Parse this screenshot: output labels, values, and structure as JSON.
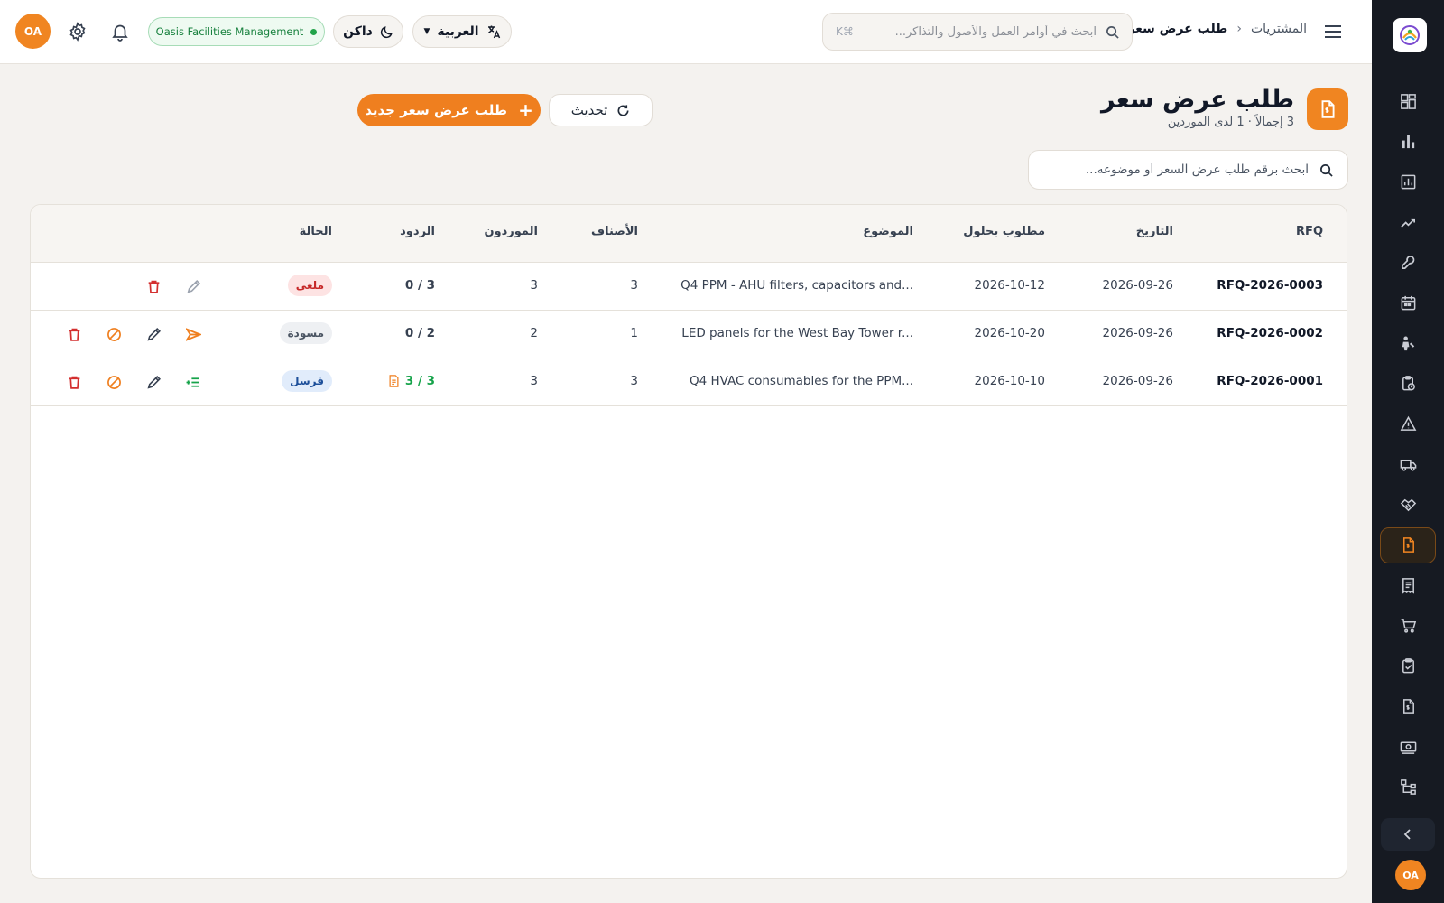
{
  "topbar": {
    "breadcrumb_parent": "المشتريات",
    "breadcrumb_current": "طلب عرض سعر",
    "search_placeholder": "ابحث في أوامر العمل والأصول والتذاكر...",
    "search_shortcut": "⌘K",
    "language": "العربية",
    "theme": "داكن",
    "org_name": "Oasis Facilities Management",
    "avatar_initials": "OA"
  },
  "sidebar": {
    "avatar_initials": "OA",
    "items": [
      {
        "icon": "dashboard-icon",
        "active": false
      },
      {
        "icon": "bar-chart-icon",
        "active": false
      },
      {
        "icon": "report-chart-icon",
        "active": false
      },
      {
        "icon": "trend-icon",
        "active": false
      },
      {
        "icon": "wrench-icon",
        "active": false
      },
      {
        "icon": "calendar-icon",
        "active": false
      },
      {
        "icon": "technician-icon",
        "active": false
      },
      {
        "icon": "clipboard-clock-icon",
        "active": false
      },
      {
        "icon": "warning-icon",
        "active": false
      },
      {
        "icon": "truck-icon",
        "active": false
      },
      {
        "icon": "handshake-icon",
        "active": false
      },
      {
        "icon": "rfq-document-icon",
        "active": true
      },
      {
        "icon": "receipt-icon",
        "active": false
      },
      {
        "icon": "cart-icon",
        "active": false
      },
      {
        "icon": "clipboard-check-icon",
        "active": false
      },
      {
        "icon": "invoice-icon",
        "active": false
      },
      {
        "icon": "payment-icon",
        "active": false
      },
      {
        "icon": "hierarchy-icon",
        "active": false
      }
    ]
  },
  "page": {
    "title": "طلب عرض سعر",
    "subtitle": "3 إجمالاً · 1 لدى الموردين",
    "refresh_label": "تحديث",
    "new_label": "طلب عرض سعر جديد",
    "search_placeholder": "ابحث برقم طلب عرض السعر أو موضوعه..."
  },
  "table": {
    "headers": {
      "rfq": "RFQ",
      "date": "التاريخ",
      "required_by": "مطلوب بحلول",
      "subject": "الموضوع",
      "items": "الأصناف",
      "suppliers": "الموردون",
      "responses": "الردود",
      "status": "الحالة"
    },
    "rows": [
      {
        "rfq": "RFQ-2026-0003",
        "date": "2026-09-26",
        "required_by": "2026-10-12",
        "subject": "Q4 PPM - AHU filters, capacitors and...",
        "items": "3",
        "suppliers": "3",
        "responses": "0 / 3",
        "status": "ملغى",
        "status_kind": "cancelled"
      },
      {
        "rfq": "RFQ-2026-0002",
        "date": "2026-09-26",
        "required_by": "2026-10-20",
        "subject": "LED panels for the West Bay Tower r...",
        "items": "1",
        "suppliers": "2",
        "responses": "0 / 2",
        "status": "مسودة",
        "status_kind": "draft"
      },
      {
        "rfq": "RFQ-2026-0001",
        "date": "2026-09-26",
        "required_by": "2026-10-10",
        "subject": "Q4 HVAC consumables for the PPM...",
        "items": "3",
        "suppliers": "3",
        "responses": "3 / 3",
        "status": "فرسل",
        "status_kind": "sent"
      }
    ]
  },
  "colors": {
    "accent": "#ef7f1f",
    "sidebar_bg": "#161a22",
    "page_bg": "#f4f2ef"
  }
}
